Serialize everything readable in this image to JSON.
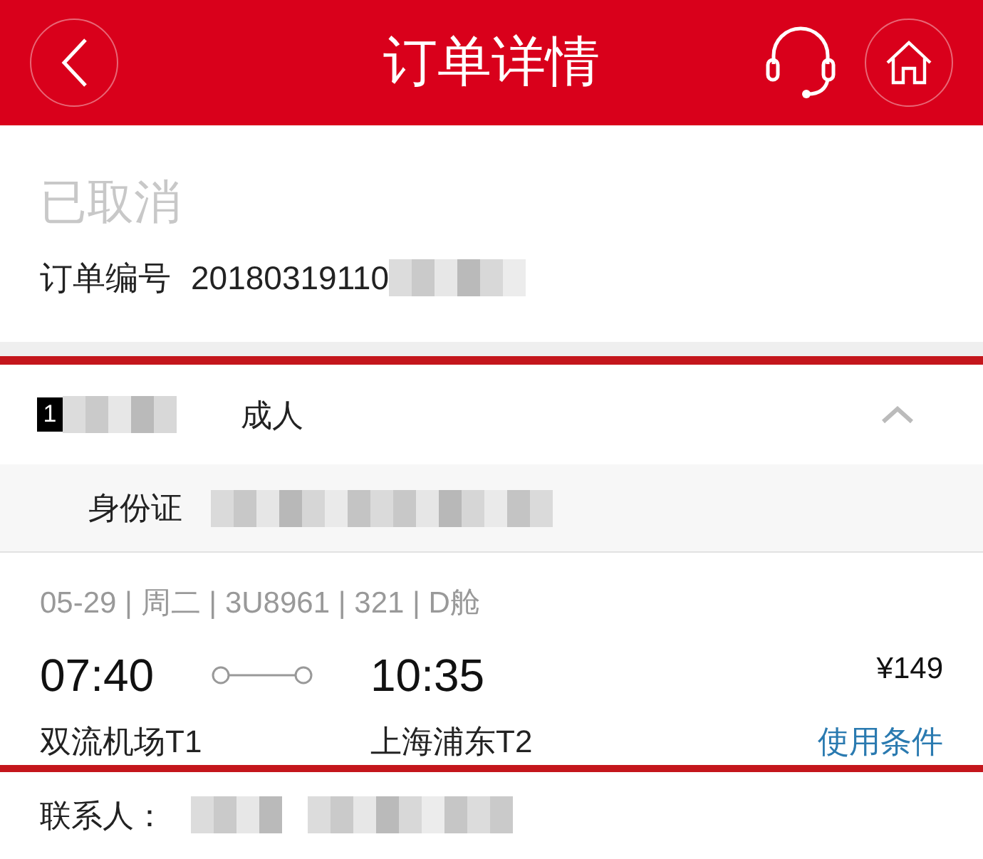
{
  "header": {
    "title": "订单详情"
  },
  "order": {
    "status": "已取消",
    "number_label": "订单编号",
    "number": "20180319110"
  },
  "passenger": {
    "index": "1",
    "type": "成人",
    "expanded": true,
    "id_label": "身份证"
  },
  "flight": {
    "info": "05-29 | 周二 | 3U8961 | 321 | D舱",
    "depart_time": "07:40",
    "arrive_time": "10:35",
    "depart_airport": "双流机场T1",
    "arrive_airport": "上海浦东T2",
    "price": "¥149",
    "conditions_link": "使用条件"
  },
  "contact": {
    "label": "联系人："
  }
}
